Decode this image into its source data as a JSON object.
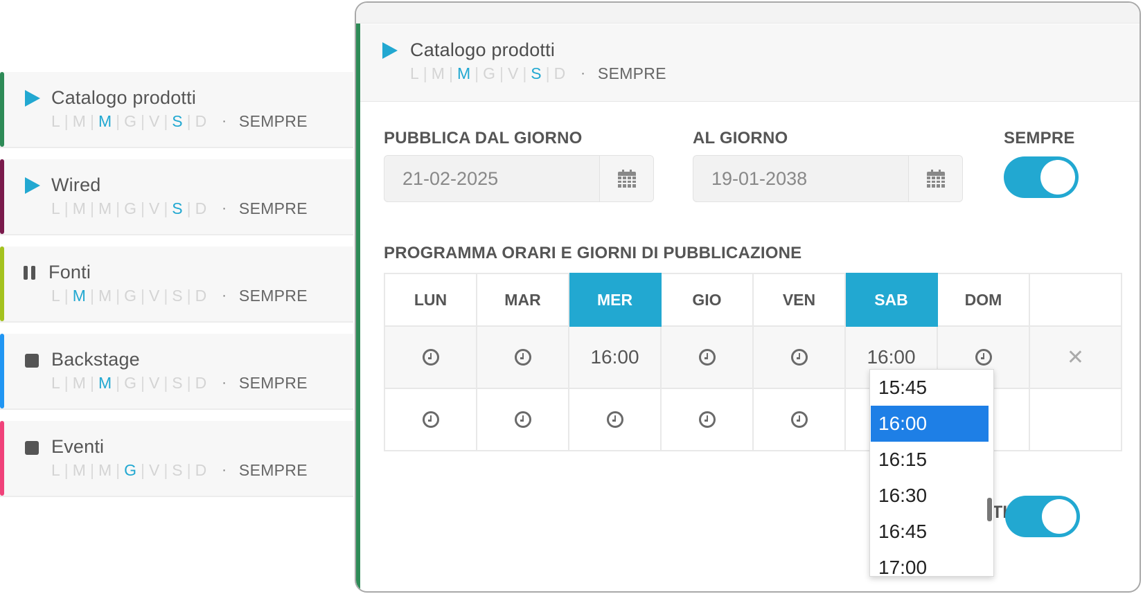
{
  "colors": {
    "accent": "#22a8d1",
    "selected_option": "#1e7fe6",
    "bar_catalogo": "#2e8b57",
    "bar_wired": "#7a1a4c",
    "bar_fonti": "#a4c21f",
    "bar_backstage": "#2196f3",
    "bar_eventi": "#f0427a"
  },
  "schedules": [
    {
      "title": "Catalogo prodotti",
      "icon": "play-icon",
      "days": [
        "L",
        "M",
        "M",
        "G",
        "V",
        "S",
        "D"
      ],
      "mode": "SEMPRE"
    },
    {
      "title": "Wired",
      "icon": "play-icon",
      "days": [
        "L",
        "M",
        "M",
        "G",
        "V",
        "S",
        "D"
      ],
      "mode": "SEMPRE"
    },
    {
      "title": "Fonti",
      "icon": "pause-icon",
      "days": [
        "L",
        "M",
        "M",
        "G",
        "V",
        "S",
        "D"
      ],
      "mode": "SEMPRE"
    },
    {
      "title": "Backstage",
      "icon": "stop-icon",
      "days": [
        "L",
        "M",
        "M",
        "G",
        "V",
        "S",
        "D"
      ],
      "mode": "SEMPRE"
    },
    {
      "title": "Eventi",
      "icon": "stop-icon",
      "days": [
        "L",
        "M",
        "M",
        "G",
        "V",
        "S",
        "D"
      ],
      "mode": "SEMPRE"
    }
  ],
  "detail": {
    "title": "Catalogo prodotti",
    "days": [
      "L",
      "M",
      "M",
      "G",
      "V",
      "S",
      "D"
    ],
    "mode": "SEMPRE",
    "from_label": "PUBBLICA DAL GIORNO",
    "from_value": "21-02-2025",
    "to_label": "AL GIORNO",
    "to_value": "19-01-2038",
    "always_label": "SEMPRE",
    "schedule_label": "PROGRAMMA ORARI E GIORNI DI PUBBLICAZIONE",
    "columns": [
      "LUN",
      "MAR",
      "MER",
      "GIO",
      "VEN",
      "SAB",
      "DOM"
    ],
    "row1": {
      "mer": "16:00",
      "sab": "16:00"
    },
    "active_label": "TIVA"
  },
  "dropdown": {
    "options": [
      "15:45",
      "16:00",
      "16:15",
      "16:30",
      "16:45",
      "17:00"
    ],
    "selected": "16:00"
  }
}
